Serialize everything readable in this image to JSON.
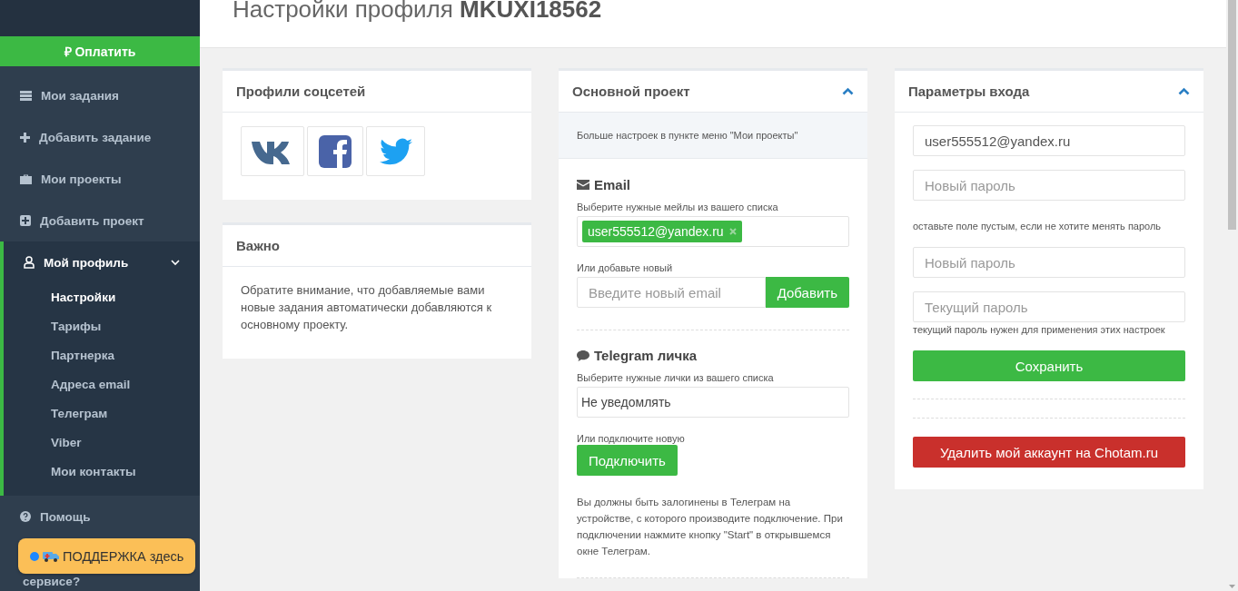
{
  "header": {
    "title": "Настройки профиля **MKUXI18562**"
  },
  "sidebar": {
    "pay_button": "₽ Оплатить",
    "items": [
      {
        "label": "Мои задания",
        "selected": false
      },
      {
        "label": "Добавить задание",
        "selected": false
      },
      {
        "label": "Мои проекты",
        "selected": false
      },
      {
        "label": "Добавить проект",
        "selected": false
      },
      {
        "label": "Мой профиль",
        "selected": true,
        "expanded": true,
        "children": [
          {
            "label": "Настройки",
            "selected": true
          },
          {
            "label": "Тарифы",
            "selected": false
          },
          {
            "label": "Партнерка",
            "selected": false
          },
          {
            "label": "Адреса email",
            "selected": false
          },
          {
            "label": "Телеграм",
            "selected": false
          },
          {
            "label": "Viber",
            "selected": false
          },
          {
            "label": "Мои контакты",
            "selected": false
          }
        ]
      },
      {
        "label": "Помощь",
        "selected": false
      }
    ],
    "cut_text": "сервисе?",
    "support_badge": "ПОДДЕРЖКА здесь"
  },
  "social_card": {
    "title": "Профили соцсетей"
  },
  "important_card": {
    "title": "Важно",
    "text": "Обратите внимание, что добавляемые вами новые задания автоматически добавляются к основному проекту."
  },
  "project_card": {
    "title": "Основной проект",
    "expanded": true,
    "info": "Больше настроек в пункте меню \"Мои проекты\"",
    "email": {
      "heading": "Email",
      "select_label": "Выберите нужные мейлы из вашего списка",
      "tags": [
        "user555512@yandex.ru"
      ],
      "add_label": "Или добавьте новый",
      "placeholder": "Введите новый email",
      "add_button": "Добавить"
    },
    "telegram": {
      "heading": "Telegram личка",
      "select_label": "Выберите нужные лички из вашего списка",
      "select_value": "Не уведомлять",
      "connect_label": "Или подключите новую",
      "connect_button": "Подключить",
      "note": "Вы должны быть залогинены в Телеграм на устройстве, с которого производите подключение. При подключении нажмите кнопку \"Start\" в открывшемся окне Телеграм."
    }
  },
  "login_card": {
    "title": "Параметры входа",
    "expanded": true,
    "items": [
      {
        "kind": "field",
        "value": "user555512@yandex.ru"
      },
      {
        "kind": "field",
        "placeholder": "Новый пароль"
      },
      {
        "kind": "hint",
        "text": "оставьте поле пустым, если не хотите менять пароль"
      },
      {
        "kind": "field",
        "placeholder": "Новый пароль"
      },
      {
        "kind": "field",
        "placeholder": "Текущий пароль"
      },
      {
        "kind": "hint",
        "text": "текущий пароль нужен для применения этих настроек"
      },
      {
        "kind": "button",
        "text": "Сохранить"
      },
      {
        "kind": "divider"
      },
      {
        "kind": "divider"
      },
      {
        "kind": "danger",
        "text": "Удалить мой аккаунт на Chotam.ru"
      }
    ]
  }
}
